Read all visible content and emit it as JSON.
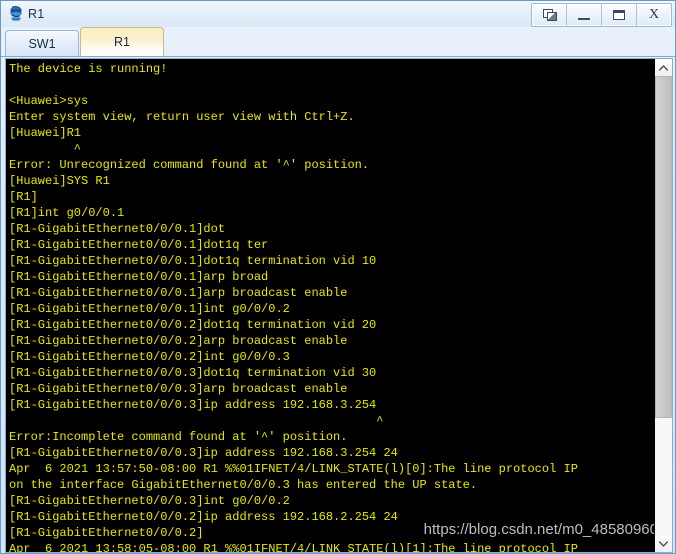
{
  "window": {
    "title": "R1",
    "icon": "router-icon",
    "buttons": [
      {
        "name": "restore-button",
        "icon": "restore-icon",
        "label": ""
      },
      {
        "name": "minimize-button",
        "icon": "minimize-icon",
        "label": ""
      },
      {
        "name": "maximize-button",
        "icon": "maximize-icon",
        "label": ""
      },
      {
        "name": "close-button",
        "icon": "close-icon",
        "label": "X"
      }
    ]
  },
  "tabs": [
    {
      "label": "SW1",
      "active": false
    },
    {
      "label": "R1",
      "active": true
    }
  ],
  "terminal": {
    "foreground_color": "#e8e800",
    "background_color": "#000000",
    "lines": [
      "The device is running!",
      "",
      "<Huawei>sys",
      "Enter system view, return user view with Ctrl+Z.",
      "[Huawei]R1",
      "         ^",
      "Error: Unrecognized command found at '^' position.",
      "[Huawei]SYS R1",
      "[R1]",
      "[R1]int g0/0/0.1",
      "[R1-GigabitEthernet0/0/0.1]dot",
      "[R1-GigabitEthernet0/0/0.1]dot1q ter",
      "[R1-GigabitEthernet0/0/0.1]dot1q termination vid 10",
      "[R1-GigabitEthernet0/0/0.1]arp broad",
      "[R1-GigabitEthernet0/0/0.1]arp broadcast enable",
      "[R1-GigabitEthernet0/0/0.1]int g0/0/0.2",
      "[R1-GigabitEthernet0/0/0.2]dot1q termination vid 20",
      "[R1-GigabitEthernet0/0/0.2]arp broadcast enable",
      "[R1-GigabitEthernet0/0/0.2]int g0/0/0.3",
      "[R1-GigabitEthernet0/0/0.3]dot1q termination vid 30",
      "[R1-GigabitEthernet0/0/0.3]arp broadcast enable",
      "[R1-GigabitEthernet0/0/0.3]ip address 192.168.3.254",
      "                                                   ^",
      "Error:Incomplete command found at '^' position.",
      "[R1-GigabitEthernet0/0/0.3]ip address 192.168.3.254 24",
      "Apr  6 2021 13:57:50-08:00 R1 %%01IFNET/4/LINK_STATE(l)[0]:The line protocol IP",
      "on the interface GigabitEthernet0/0/0.3 has entered the UP state.",
      "[R1-GigabitEthernet0/0/0.3]int g0/0/0.2",
      "[R1-GigabitEthernet0/0/0.2]ip address 192.168.2.254 24",
      "[R1-GigabitEthernet0/0/0.2]",
      "Apr  6 2021 13:58:05-08:00 R1 %%01IFNET/4/LINK_STATE(l)[1]:The line protocol IP"
    ],
    "watermark": "https://blog.csdn.net/m0_48580960"
  },
  "scrollbar": {
    "up_arrow": "chevron-up-icon",
    "down_arrow": "chevron-down-icon",
    "thumb_position_percent": 0,
    "thumb_size_percent": 74.5
  }
}
